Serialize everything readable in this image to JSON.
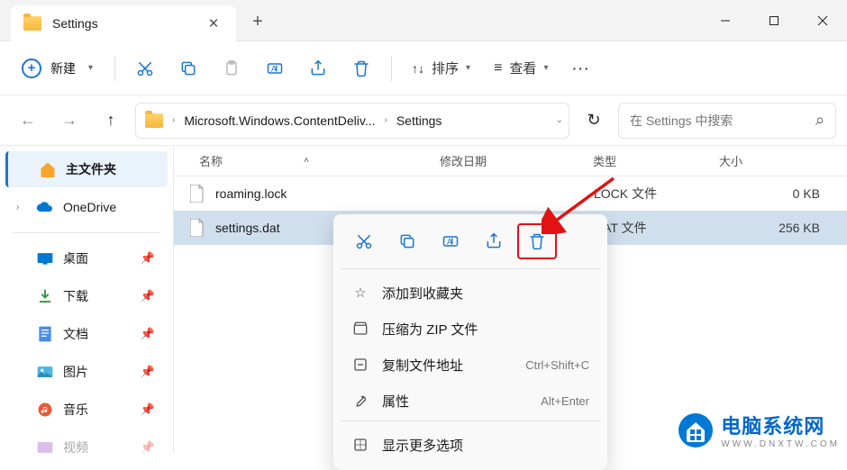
{
  "titlebar": {
    "tab_title": "Settings"
  },
  "toolbar": {
    "new_label": "新建",
    "sort_label": "排序",
    "view_label": "查看"
  },
  "navbar": {
    "crumb1": "Microsoft.Windows.ContentDeliv...",
    "crumb2": "Settings",
    "search_placeholder": "在 Settings 中搜索"
  },
  "sidebar": {
    "home": "主文件夹",
    "onedrive": "OneDrive",
    "desktop": "桌面",
    "downloads": "下载",
    "documents": "文档",
    "pictures": "图片",
    "music": "音乐",
    "videos": "视频"
  },
  "columns": {
    "name": "名称",
    "date": "修改日期",
    "type": "类型",
    "size": "大小"
  },
  "files": [
    {
      "name": "roaming.lock",
      "type": "LOCK 文件",
      "size": "0 KB"
    },
    {
      "name": "settings.dat",
      "type": "DAT 文件",
      "size": "256 KB"
    }
  ],
  "context_menu": {
    "favorite": "添加到收藏夹",
    "zip": "压缩为 ZIP 文件",
    "copy_path": "复制文件地址",
    "copy_path_key": "Ctrl+Shift+C",
    "properties": "属性",
    "properties_key": "Alt+Enter",
    "more": "显示更多选项"
  },
  "watermark": {
    "title": "电脑系统网",
    "url": "WWW.DNXTW.COM"
  }
}
